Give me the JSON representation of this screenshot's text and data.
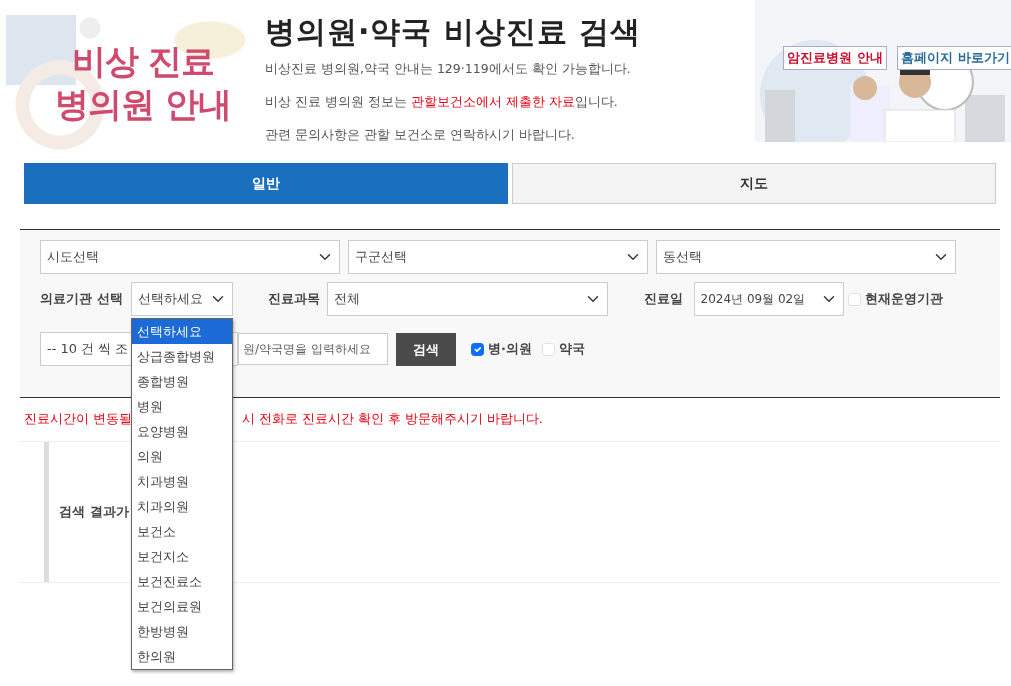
{
  "banner_left": {
    "title_lines": [
      "비상 진료",
      "병의원 안내"
    ]
  },
  "header": {
    "title": "병의원·약국 비상진료 검색",
    "notes": [
      {
        "segments": [
          {
            "text": "비상진료 병의원,약국 안내는 129·119에서도 확인 가능합니다.",
            "highlight": false
          }
        ]
      },
      {
        "segments": [
          {
            "text": "비상 진료 병의원 정보는 ",
            "highlight": false
          },
          {
            "text": "관할보건소에서 제출한 자료",
            "highlight": true
          },
          {
            "text": "입니다.",
            "highlight": false
          }
        ]
      },
      {
        "segments": [
          {
            "text": "관련 문의사항은 관할 보건소로 연락하시기 바랍니다.",
            "highlight": false
          }
        ]
      }
    ]
  },
  "banner_right": {
    "links": [
      "암진료병원 안내",
      "홈페이지 바로가기"
    ]
  },
  "tabs": [
    {
      "label": "일반",
      "selected": true
    },
    {
      "label": "지도",
      "selected": false
    }
  ],
  "filters": {
    "region_selects": [
      "시도선택",
      "구군선택",
      "동선택"
    ],
    "institution": {
      "label": "의료기관 선택",
      "value": "선택하세요",
      "expanded": true,
      "options": [
        {
          "label": "선택하세요",
          "selected": true
        },
        {
          "label": "상급종합병원",
          "selected": false
        },
        {
          "label": "종합병원",
          "selected": false
        },
        {
          "label": "병원",
          "selected": false
        },
        {
          "label": "요양병원",
          "selected": false
        },
        {
          "label": "의원",
          "selected": false
        },
        {
          "label": "치과병원",
          "selected": false
        },
        {
          "label": "치과의원",
          "selected": false
        },
        {
          "label": "보건소",
          "selected": false
        },
        {
          "label": "보건지소",
          "selected": false
        },
        {
          "label": "보건진료소",
          "selected": false
        },
        {
          "label": "보건의료원",
          "selected": false
        },
        {
          "label": "한방병원",
          "selected": false
        },
        {
          "label": "한의원",
          "selected": false
        }
      ]
    },
    "department": {
      "label": "진료과목",
      "value": "전체"
    },
    "date": {
      "label": "진료일",
      "value": "2024년 09월 02일"
    },
    "open_now": {
      "label": "현재운영기관",
      "checked": false
    },
    "page_size": {
      "value": "-- 10 건 씩 조"
    },
    "name_search": {
      "placeholder": "원/약국명을 입력하세요"
    },
    "search_button": "검색",
    "types": [
      {
        "label": "병·의원",
        "checked": true
      },
      {
        "label": "약국",
        "checked": false
      }
    ]
  },
  "notice": [
    "진료시간이 변동될",
    "시 전화로 진료시간 확인 후 방문해주시기 바랍니다."
  ],
  "results": {
    "message": "검색 결과가"
  }
}
